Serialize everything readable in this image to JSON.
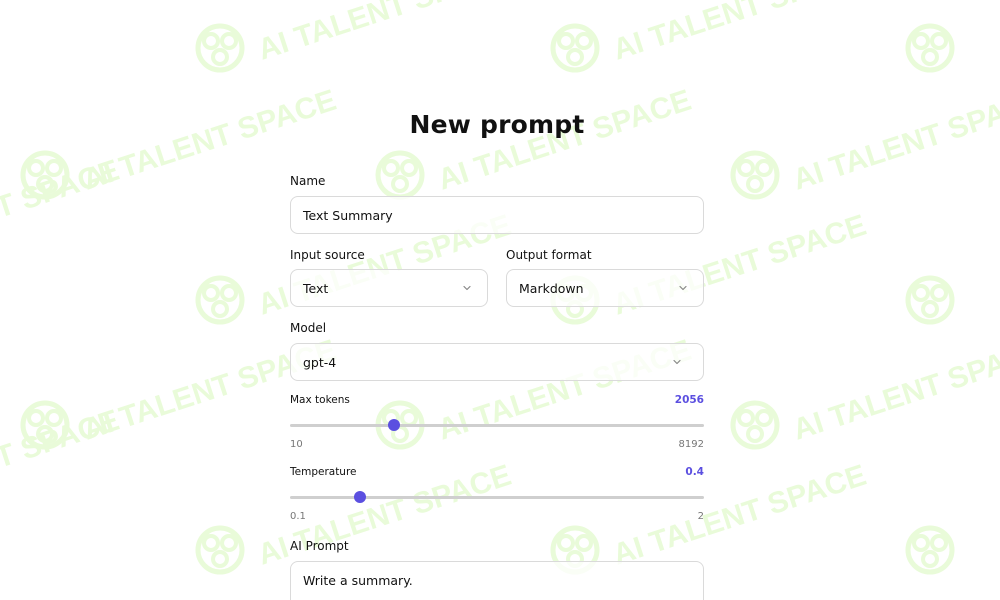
{
  "watermark": {
    "text": "AI TALENT SPACE"
  },
  "page": {
    "title": "New prompt"
  },
  "name": {
    "label": "Name",
    "value": "Text Summary"
  },
  "input_source": {
    "label": "Input source",
    "value": "Text"
  },
  "output_format": {
    "label": "Output format",
    "value": "Markdown"
  },
  "model": {
    "label": "Model",
    "value": "gpt-4"
  },
  "max_tokens": {
    "label": "Max tokens",
    "value": "2056",
    "min": "10",
    "max": "8192",
    "position_fraction": 0.25
  },
  "temperature": {
    "label": "Temperature",
    "value": "0.4",
    "min": "0.1",
    "max": "2",
    "position_fraction": 0.168
  },
  "ai_prompt": {
    "label": "AI Prompt",
    "value": "Write a summary."
  },
  "colors": {
    "accent": "#5b4fe0",
    "watermark": "#e9fbd9",
    "track": "#cfcfcf"
  }
}
